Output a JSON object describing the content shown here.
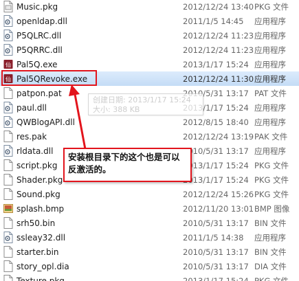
{
  "files": [
    {
      "name": "Music.pkg",
      "date": "2012/12/24 13:40",
      "type": "PKG 文件",
      "icon": "pkg-file-icon"
    },
    {
      "name": "openldap.dll",
      "date": "2011/1/5 14:45",
      "type": "应用程序",
      "icon": "dll-file-icon"
    },
    {
      "name": "P5QLRC.dll",
      "date": "2012/12/24 11:23",
      "type": "应用程序",
      "icon": "dll-file-icon"
    },
    {
      "name": "P5QRRC.dll",
      "date": "2012/12/24 11:23",
      "type": "应用程序",
      "icon": "dll-file-icon"
    },
    {
      "name": "Pal5Q.exe",
      "date": "2013/1/17 15:24",
      "type": "应用程序",
      "icon": "app-exe-icon"
    },
    {
      "name": "Pal5QRevoke.exe",
      "date": "2012/12/24 11:30",
      "type": "应用程序",
      "icon": "app-exe-icon"
    },
    {
      "name": "patpon.pat",
      "date": "2010/5/31 13:17",
      "type": "PAT 文件",
      "icon": "generic-file-icon"
    },
    {
      "name": "paul.dll",
      "date": "2013/1/17 15:24",
      "type": "应用程序",
      "icon": "dll-file-icon"
    },
    {
      "name": "QWBlogAPI.dll",
      "date": "2012/8/15 18:40",
      "type": "应用程序",
      "icon": "dll-file-icon"
    },
    {
      "name": "res.pak",
      "date": "2012/12/24 13:19",
      "type": "PAK 文件",
      "icon": "generic-file-icon"
    },
    {
      "name": "rldata.dll",
      "date": "2010/5/31 13:17",
      "type": "应用程序",
      "icon": "dll-file-icon"
    },
    {
      "name": "script.pkg",
      "date": "2013/1/17 15:24",
      "type": "PKG 文件",
      "icon": "generic-file-icon"
    },
    {
      "name": "Shader.pkg",
      "date": "2013/1/17 15:24",
      "type": "PKG 文件",
      "icon": "generic-file-icon"
    },
    {
      "name": "Sound.pkg",
      "date": "2012/12/24 15:26",
      "type": "PKG 文件",
      "icon": "generic-file-icon"
    },
    {
      "name": "splash.bmp",
      "date": "2012/11/20 13:01",
      "type": "BMP 图像",
      "icon": "bitmap-image-icon"
    },
    {
      "name": "srh50.bin",
      "date": "2010/5/31 13:17",
      "type": "BIN 文件",
      "icon": "generic-file-icon"
    },
    {
      "name": "ssleay32.dll",
      "date": "2011/1/5 14:38",
      "type": "应用程序",
      "icon": "dll-file-icon"
    },
    {
      "name": "starter.bin",
      "date": "2010/5/31 13:17",
      "type": "BIN 文件",
      "icon": "generic-file-icon"
    },
    {
      "name": "story_opl.dia",
      "date": "2010/5/31 13:17",
      "type": "DIA 文件",
      "icon": "generic-file-icon"
    },
    {
      "name": "Texture.pkg",
      "date": "2013/1/17 15:24",
      "type": "PKG 文件",
      "icon": "generic-file-icon"
    }
  ],
  "tooltip": {
    "line1": "创建日期: 2013/1/17 15:24",
    "line2": "大小: 388 KB"
  },
  "callout": {
    "text": "安装根目录下的这个也是可以反激活的。"
  },
  "colors": {
    "annotation_red": "#e2141c",
    "selection_blue": "#cce4f7"
  }
}
